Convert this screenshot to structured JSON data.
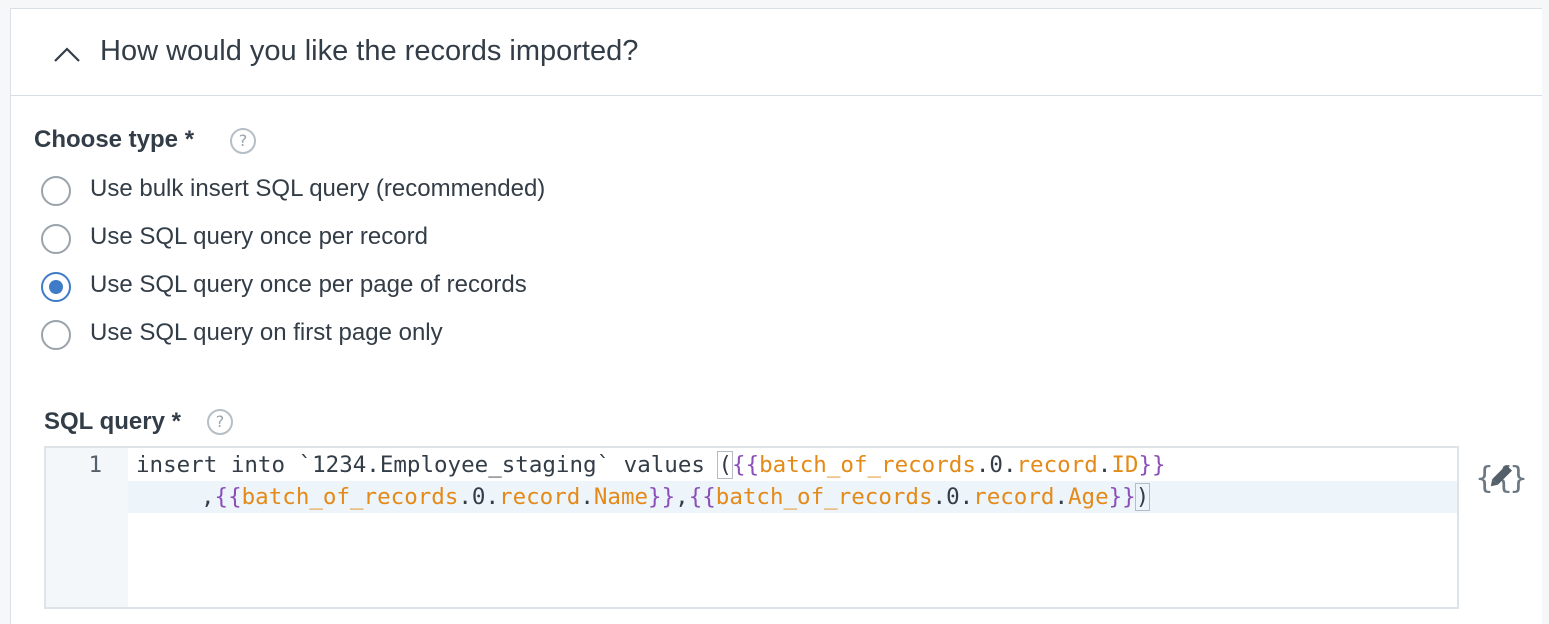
{
  "accordion": {
    "title": "How would you like the records imported?",
    "icon": "chevron-up-icon"
  },
  "choose_type": {
    "label": "Choose type *",
    "help_icon": "question-mark-icon",
    "help_glyph": "?",
    "options": [
      {
        "label": "Use bulk insert SQL query (recommended)",
        "selected": false
      },
      {
        "label": "Use SQL query once per record",
        "selected": false
      },
      {
        "label": "Use SQL query once per page of records",
        "selected": true
      },
      {
        "label": "Use SQL query on first page only",
        "selected": false
      }
    ]
  },
  "sql_query": {
    "label": "SQL query *",
    "help_icon": "question-mark-icon",
    "help_glyph": "?",
    "line_number": "1",
    "line1": {
      "prefix": "insert into `1234.Employee_staging` values ",
      "paren_open": "(",
      "open": "{{",
      "var1": "batch_of_records",
      "mid1": ".0.",
      "var2": "record",
      "dot": ".",
      "var3": "ID",
      "close": "}}"
    },
    "line2": {
      "comma1": ",",
      "open1": "{{",
      "var1": "batch_of_records",
      "mid1": ".0.",
      "var2": "record",
      "dot1": ".",
      "var3": "Name",
      "close1": "}}",
      "comma2": ",",
      "open2": "{{",
      "var4": "batch_of_records",
      "mid2": ".0.",
      "var5": "record",
      "dot2": ".",
      "var6": "Age",
      "close2": "}}",
      "paren_close": ")"
    },
    "handlebars_icon": "handlebars-edit-icon"
  },
  "colors": {
    "accent": "#3f7cc7",
    "brace": "#8a4fb8",
    "variable": "#e48a18",
    "text": "#333d47"
  }
}
